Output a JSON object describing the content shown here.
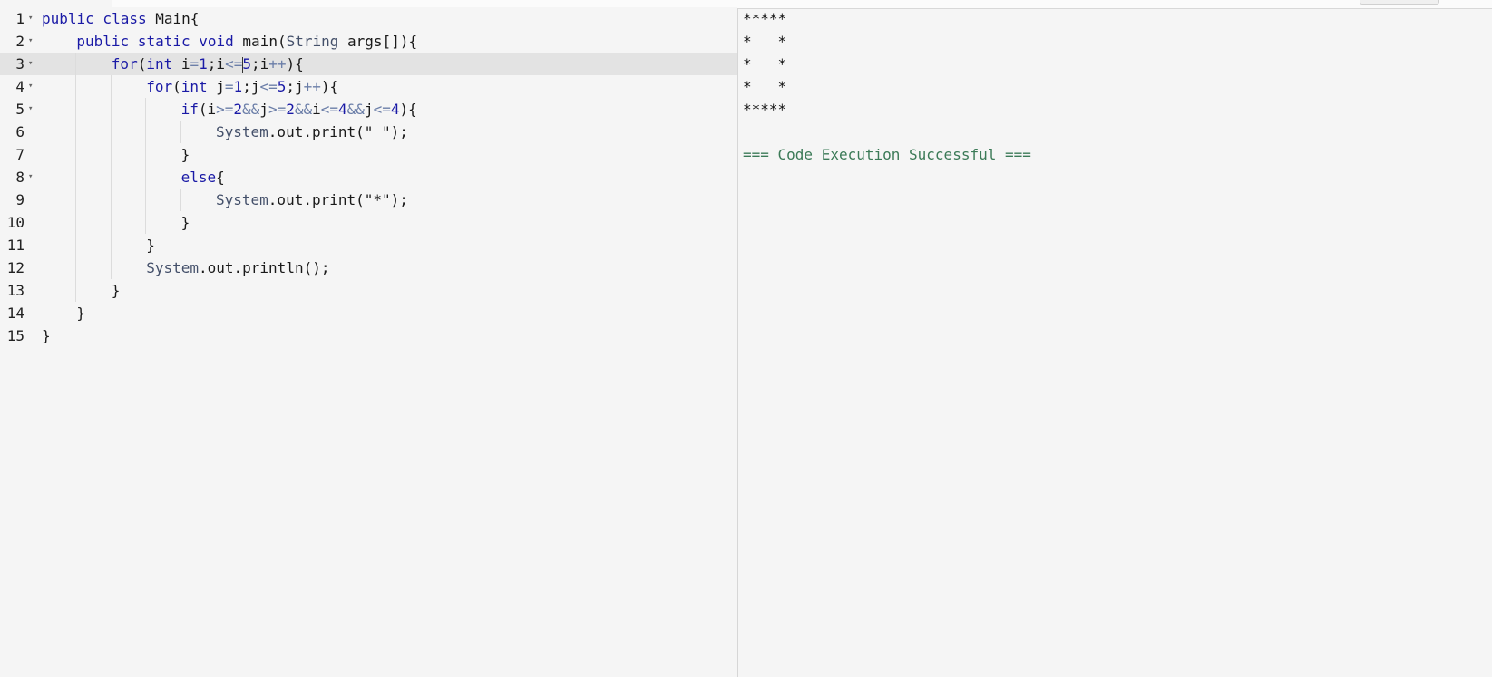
{
  "editor": {
    "active_line": 3,
    "lines": [
      {
        "num": "1",
        "fold": true,
        "indent": 0,
        "tokens": [
          [
            "kw",
            "public class "
          ],
          [
            "txt",
            "Main{"
          ]
        ]
      },
      {
        "num": "2",
        "fold": true,
        "indent": 1,
        "tokens": [
          [
            "kw",
            "public static void "
          ],
          [
            "txt",
            "main("
          ],
          [
            "sys",
            "String"
          ],
          [
            "txt",
            " args[]){"
          ]
        ]
      },
      {
        "num": "3",
        "fold": true,
        "indent": 2,
        "tokens": [
          [
            "kw",
            "for"
          ],
          [
            "txt",
            "("
          ],
          [
            "kw",
            "int"
          ],
          [
            "txt",
            " i"
          ],
          [
            "op",
            "="
          ],
          [
            "num",
            "1"
          ],
          [
            "txt",
            ";i"
          ],
          [
            "op",
            "<="
          ],
          [
            "cursor",
            ""
          ],
          [
            "num",
            "5"
          ],
          [
            "txt",
            ";i"
          ],
          [
            "op",
            "++"
          ],
          [
            "txt",
            "){"
          ]
        ]
      },
      {
        "num": "4",
        "fold": true,
        "indent": 3,
        "tokens": [
          [
            "kw",
            "for"
          ],
          [
            "txt",
            "("
          ],
          [
            "kw",
            "int"
          ],
          [
            "txt",
            " j"
          ],
          [
            "op",
            "="
          ],
          [
            "num",
            "1"
          ],
          [
            "txt",
            ";j"
          ],
          [
            "op",
            "<="
          ],
          [
            "num",
            "5"
          ],
          [
            "txt",
            ";j"
          ],
          [
            "op",
            "++"
          ],
          [
            "txt",
            "){"
          ]
        ]
      },
      {
        "num": "5",
        "fold": true,
        "indent": 4,
        "tokens": [
          [
            "kw",
            "if"
          ],
          [
            "txt",
            "(i"
          ],
          [
            "op",
            ">="
          ],
          [
            "num",
            "2"
          ],
          [
            "op",
            "&&"
          ],
          [
            "txt",
            "j"
          ],
          [
            "op",
            ">="
          ],
          [
            "num",
            "2"
          ],
          [
            "op",
            "&&"
          ],
          [
            "txt",
            "i"
          ],
          [
            "op",
            "<="
          ],
          [
            "num",
            "4"
          ],
          [
            "op",
            "&&"
          ],
          [
            "txt",
            "j"
          ],
          [
            "op",
            "<="
          ],
          [
            "num",
            "4"
          ],
          [
            "txt",
            "){"
          ]
        ]
      },
      {
        "num": "6",
        "fold": false,
        "indent": 5,
        "tokens": [
          [
            "sys",
            "System"
          ],
          [
            "txt",
            ".out.print("
          ],
          [
            "str",
            "\" \""
          ],
          [
            "txt",
            ");"
          ]
        ]
      },
      {
        "num": "7",
        "fold": false,
        "indent": 4,
        "tokens": [
          [
            "txt",
            "}"
          ]
        ]
      },
      {
        "num": "8",
        "fold": true,
        "indent": 4,
        "tokens": [
          [
            "kw",
            "else"
          ],
          [
            "txt",
            "{"
          ]
        ]
      },
      {
        "num": "9",
        "fold": false,
        "indent": 5,
        "tokens": [
          [
            "sys",
            "System"
          ],
          [
            "txt",
            ".out.print("
          ],
          [
            "str",
            "\"*\""
          ],
          [
            "txt",
            ");"
          ]
        ]
      },
      {
        "num": "10",
        "fold": false,
        "indent": 4,
        "tokens": [
          [
            "txt",
            "}"
          ]
        ]
      },
      {
        "num": "11",
        "fold": false,
        "indent": 3,
        "tokens": [
          [
            "txt",
            "}"
          ]
        ]
      },
      {
        "num": "12",
        "fold": false,
        "indent": 3,
        "tokens": [
          [
            "sys",
            "System"
          ],
          [
            "txt",
            ".out.println();"
          ]
        ]
      },
      {
        "num": "13",
        "fold": false,
        "indent": 2,
        "tokens": [
          [
            "txt",
            "}"
          ]
        ]
      },
      {
        "num": "14",
        "fold": false,
        "indent": 1,
        "tokens": [
          [
            "txt",
            "}"
          ]
        ]
      },
      {
        "num": "15",
        "fold": false,
        "indent": 0,
        "tokens": [
          [
            "txt",
            "}"
          ]
        ]
      }
    ]
  },
  "output": {
    "lines": [
      "*****",
      "*   *",
      "*   *",
      "*   *",
      "*****",
      ""
    ],
    "status": "=== Code Execution Successful ==="
  },
  "colors": {
    "keyword": "#1a1aa6",
    "operator": "#6b7ea8",
    "success": "#3b7a57",
    "active_line_bg": "#e3e3e3"
  },
  "icons": {
    "fold": "fold-arrow-icon"
  }
}
